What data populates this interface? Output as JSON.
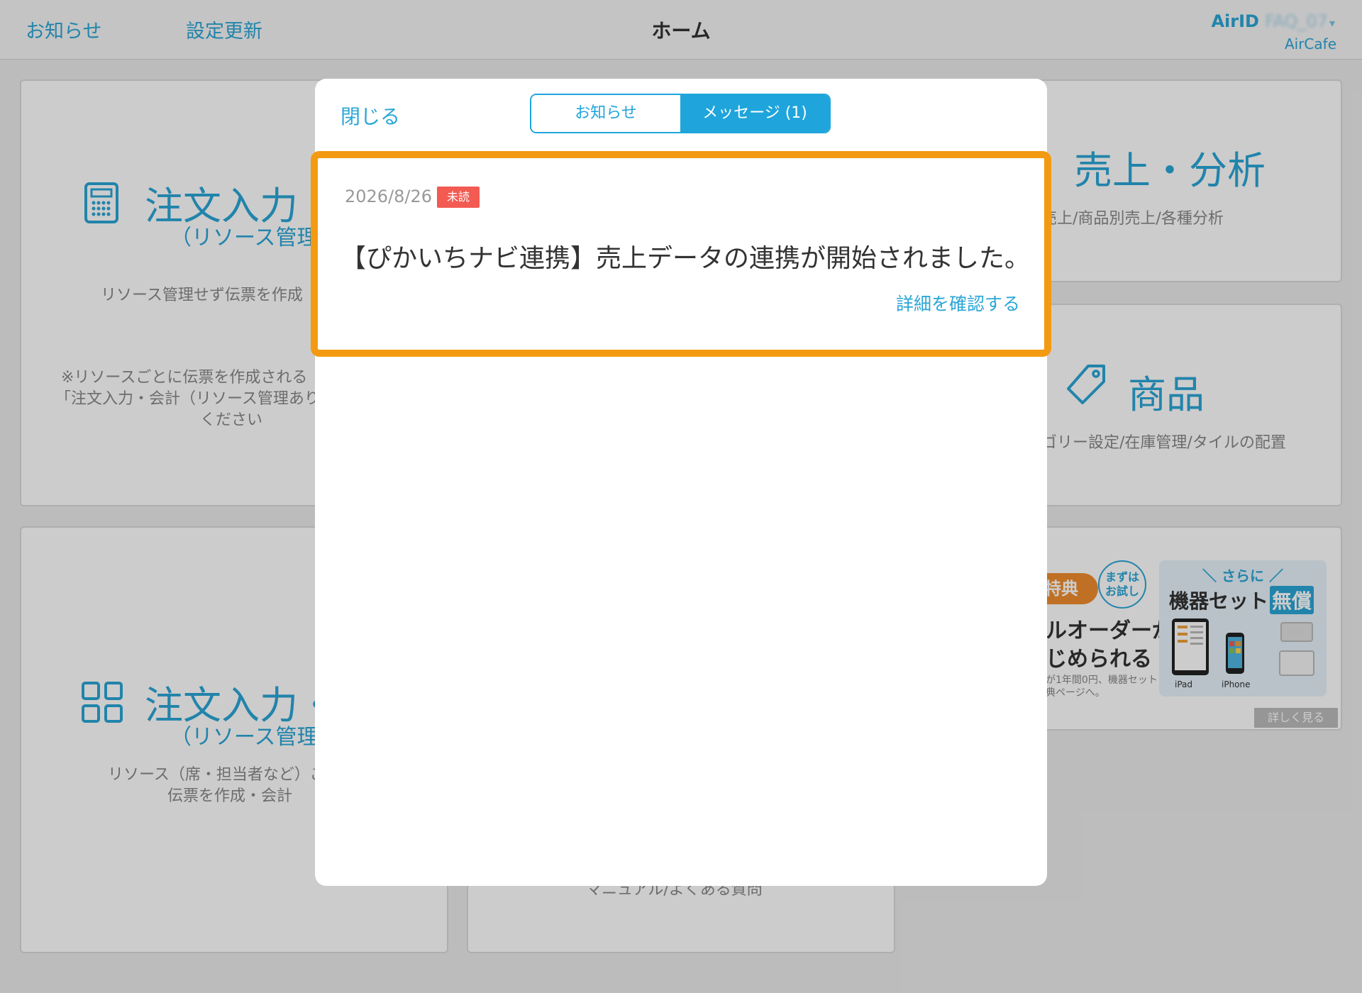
{
  "header": {
    "notice_label": "お知らせ",
    "update_label": "設定更新",
    "title": "ホーム",
    "airid_label": "AirID",
    "airid_value": "FAQ_07",
    "store_name": "AirCafe"
  },
  "cards": {
    "order_calc": {
      "title": "注文入力・",
      "sub": "（リソース管理",
      "desc1": "リソース管理せず伝票を作成",
      "note1": "※リソースごとに伝票を作成される",
      "note2": "「注文入力・会計（リソース管理あり",
      "note3": "ください"
    },
    "order_resource": {
      "title": "注文入力・",
      "sub": "（リソース管理あ",
      "desc1": "リソース（席・担当者など）ご",
      "desc2": "伝票を作成・会計"
    },
    "sales": {
      "title": "売上・分析",
      "desc": "売上/商品別売上/各種分析"
    },
    "products": {
      "title": "商品",
      "desc": "ゴリー設定/在庫管理/タイルの配置"
    },
    "support": {
      "desc": "マニュアル/よくある質問"
    },
    "promo": {
      "badge": "特典",
      "circle": "まずは お試し",
      "line1": "ルオーダーが",
      "line2": "じめられる",
      "small1": "が1年間0円、機器セット",
      "small2": "典ページへ。",
      "box_head": "＼ さらに ／",
      "box_title": "機器セット",
      "box_free": "無償",
      "device1": "iPad",
      "device2": "iPhone",
      "more": "詳しく見る"
    }
  },
  "modal": {
    "close_label": "閉じる",
    "tabs": [
      {
        "label": "お知らせ",
        "active": false
      },
      {
        "label": "メッセージ (1)",
        "active": true
      }
    ],
    "message": {
      "date": "2026/8/26",
      "status": "未読",
      "title": "【ぴかいちナビ連携】売上データの連携が開始されました。",
      "link": "詳細を確認する"
    }
  },
  "colors": {
    "accent": "#2aa6d6",
    "highlight": "#f39a12",
    "unread": "#f25a52"
  }
}
